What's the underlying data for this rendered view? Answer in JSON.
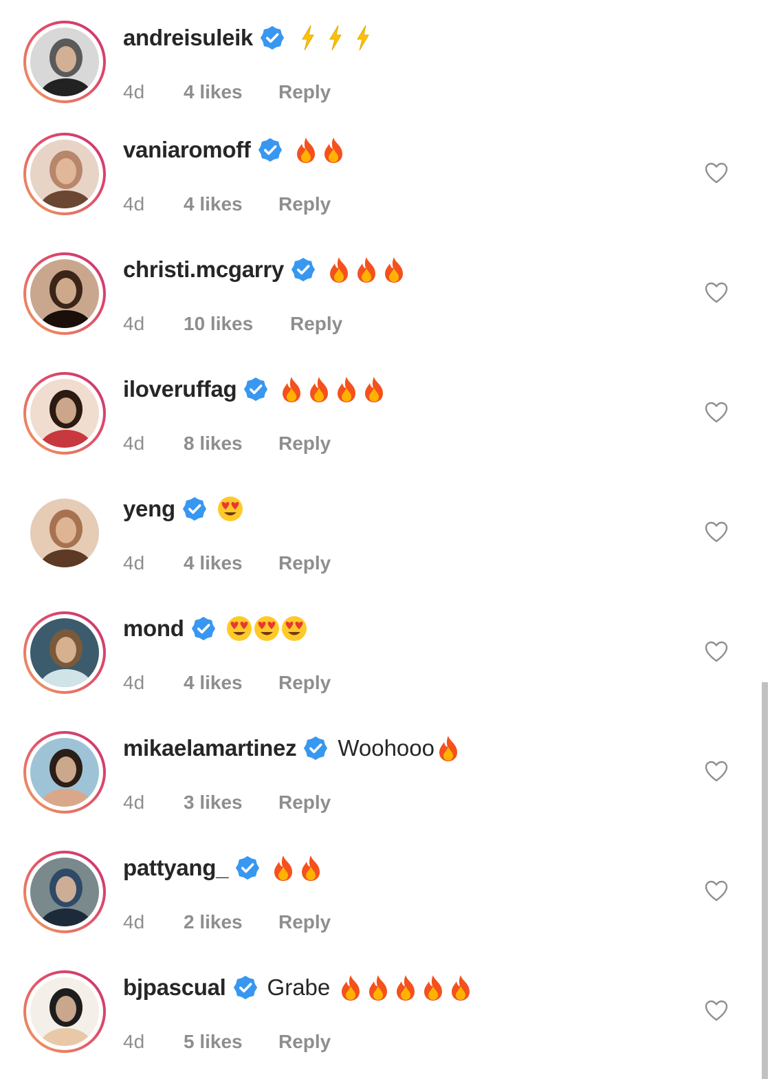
{
  "comments": [
    {
      "username": "andreisuleik",
      "verified": true,
      "text": "",
      "emoji": "⚡⚡⚡",
      "time": "4d",
      "likes": "4 likes",
      "reply": "Reply",
      "has_story_ring": true,
      "show_heart": false
    },
    {
      "username": "vaniaromoff",
      "verified": true,
      "text": "",
      "emoji": "🔥🔥",
      "time": "4d",
      "likes": "4 likes",
      "reply": "Reply",
      "has_story_ring": true,
      "show_heart": true
    },
    {
      "username": "christi.mcgarry",
      "verified": true,
      "text": "",
      "emoji": "🔥🔥🔥",
      "time": "4d",
      "likes": "10 likes",
      "reply": "Reply",
      "has_story_ring": true,
      "show_heart": true
    },
    {
      "username": "iloveruffag",
      "verified": true,
      "text": "",
      "emoji": "🔥🔥🔥🔥",
      "time": "4d",
      "likes": "8 likes",
      "reply": "Reply",
      "has_story_ring": true,
      "show_heart": true
    },
    {
      "username": "yeng",
      "verified": true,
      "text": "",
      "emoji": "😍",
      "time": "4d",
      "likes": "4 likes",
      "reply": "Reply",
      "has_story_ring": false,
      "show_heart": true
    },
    {
      "username": "mond",
      "verified": true,
      "text": "",
      "emoji": "😍😍😍",
      "time": "4d",
      "likes": "4 likes",
      "reply": "Reply",
      "has_story_ring": true,
      "show_heart": true
    },
    {
      "username": "mikaelamartinez",
      "verified": true,
      "text": "Woohooo",
      "emoji": "🔥",
      "time": "4d",
      "likes": "3 likes",
      "reply": "Reply",
      "has_story_ring": true,
      "show_heart": true
    },
    {
      "username": "pattyang_",
      "verified": true,
      "text": "",
      "emoji": "🔥🔥",
      "time": "4d",
      "likes": "2 likes",
      "reply": "Reply",
      "has_story_ring": true,
      "show_heart": true
    },
    {
      "username": "bjpascual",
      "verified": true,
      "text": "Grabe",
      "emoji": "🔥🔥🔥🔥🔥",
      "time": "4d",
      "likes": "5 likes",
      "reply": "Reply",
      "has_story_ring": true,
      "show_heart": true
    }
  ],
  "colors": {
    "username": "#262626",
    "meta": "#8e8e8e",
    "verified_badge": "#3897f0",
    "story_ring_start": "#c9306e",
    "story_ring_end": "#f0a160",
    "heart_outline": "#8e8e8e"
  },
  "icons": {
    "verified": "verified-badge-icon",
    "like": "heart-outline-icon",
    "fire": "fire-emoji",
    "lightning": "lightning-emoji",
    "heart_eyes": "heart-eyes-emoji"
  }
}
